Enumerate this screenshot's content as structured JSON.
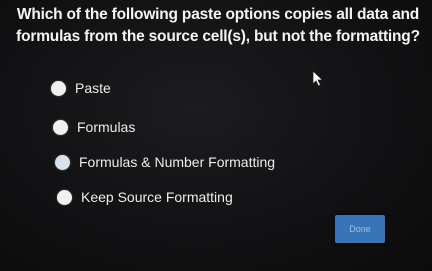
{
  "question": "Which of the following paste options copies all data and formulas from the source cell(s), but not the formatting?",
  "options": [
    {
      "label": "Paste"
    },
    {
      "label": "Formulas"
    },
    {
      "label": "Formulas & Number Formatting"
    },
    {
      "label": "Keep Source Formatting"
    }
  ],
  "done_button": "Done",
  "colors": {
    "background": "#131315",
    "button": "#3a74b8",
    "text": "#f2f2f2"
  }
}
